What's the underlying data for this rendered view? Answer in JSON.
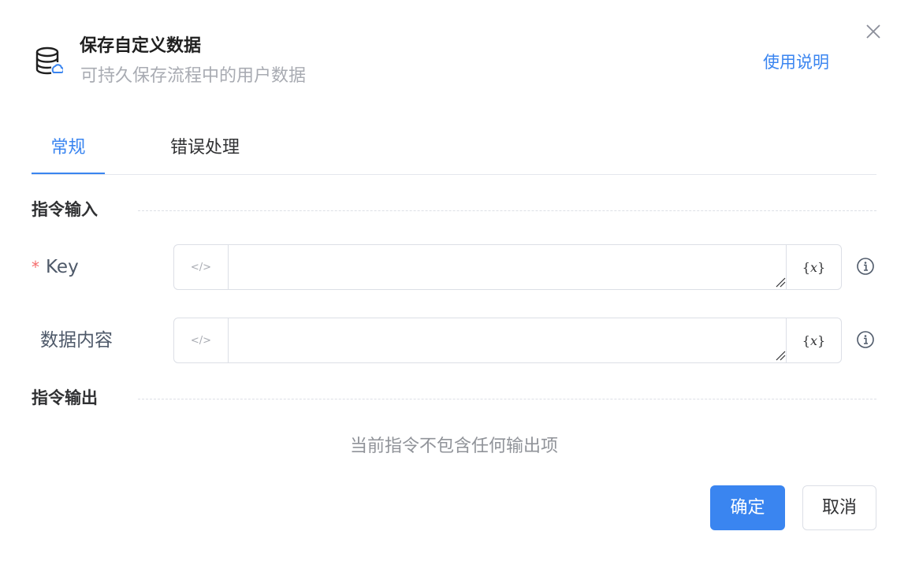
{
  "header": {
    "icon": "database-icon",
    "title": "保存自定义数据",
    "subtitle": "可持久保存流程中的用户数据",
    "help_link": "使用说明"
  },
  "tabs": [
    {
      "label": "常规",
      "active": true
    },
    {
      "label": "错误处理",
      "active": false
    }
  ],
  "sections": {
    "input": "指令输入",
    "output": "指令输出"
  },
  "fields": [
    {
      "label": "Key",
      "required": true,
      "value": "",
      "code_icon": "</>",
      "var_label_open": "{",
      "var_label_x": "x",
      "var_label_close": "}"
    },
    {
      "label": "数据内容",
      "required": false,
      "value": "",
      "code_icon": "</>",
      "var_label_open": "{",
      "var_label_x": "x",
      "var_label_close": "}"
    }
  ],
  "required_mark": "*",
  "output_empty": "当前指令不包含任何输出项",
  "footer": {
    "confirm": "确定",
    "cancel": "取消"
  },
  "colors": {
    "accent": "#3a85f0",
    "required": "#f56c6c"
  }
}
